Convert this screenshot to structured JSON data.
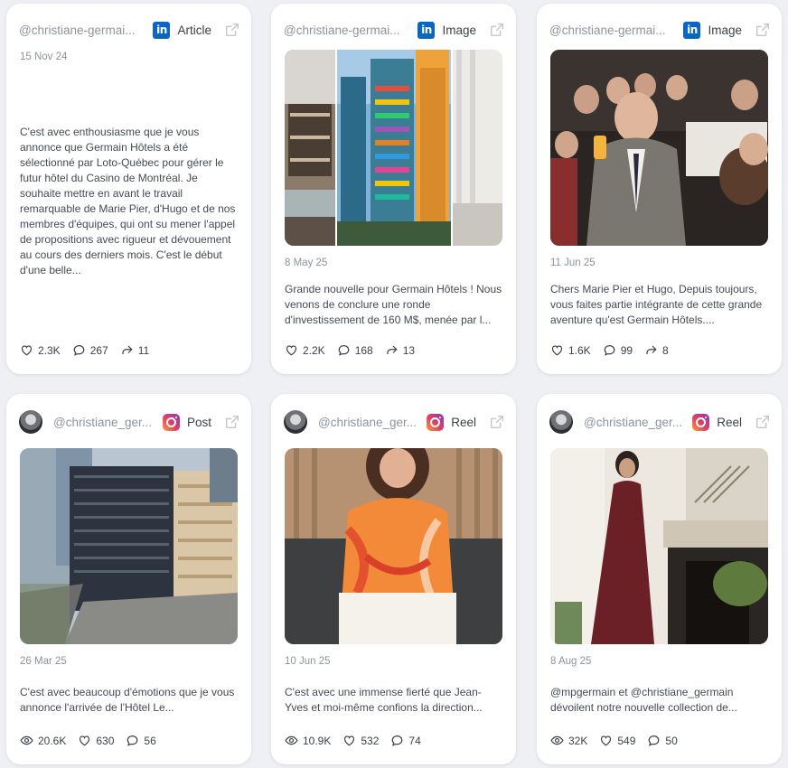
{
  "cards": [
    {
      "handle": "@christiane-germai...",
      "platform": "Article",
      "platform_icon": "linkedin-icon",
      "date": "15 Nov 24",
      "text": "C'est avec enthousiasme que je vous annonce que Germain Hôtels a été sélectionné par Loto-Québec pour gérer le futur hôtel du Casino de Montréal. Je souhaite mettre en avant le travail remarquable de Marie Pier, d'Hugo et de nos membres d'équipes, qui ont su mener l'appel de propositions avec rigueur et dévouement au cours des derniers mois. C'est le début d'une belle...",
      "stats": [
        {
          "icon": "heart-icon",
          "value": "2.3K"
        },
        {
          "icon": "comment-icon",
          "value": "267"
        },
        {
          "icon": "share-icon",
          "value": "11"
        }
      ]
    },
    {
      "handle": "@christiane-germai...",
      "platform": "Image",
      "platform_icon": "linkedin-icon",
      "date": "8 May 25",
      "text": "Grande nouvelle pour Germain Hôtels ! Nous venons de conclure une ronde d'investissement de 160 M$, menée par l...",
      "stats": [
        {
          "icon": "heart-icon",
          "value": "2.2K"
        },
        {
          "icon": "comment-icon",
          "value": "168"
        },
        {
          "icon": "share-icon",
          "value": "13"
        }
      ]
    },
    {
      "handle": "@christiane-germai...",
      "platform": "Image",
      "platform_icon": "linkedin-icon",
      "date": "11 Jun 25",
      "text": "Chers Marie Pier et Hugo, Depuis toujours, vous faites partie intégrante de cette grande aventure qu'est Germain Hôtels....",
      "stats": [
        {
          "icon": "heart-icon",
          "value": "1.6K"
        },
        {
          "icon": "comment-icon",
          "value": "99"
        },
        {
          "icon": "share-icon",
          "value": "8"
        }
      ]
    },
    {
      "handle": "@christiane_ger...",
      "platform": "Post",
      "platform_icon": "instagram-icon",
      "date": "26 Mar 25",
      "text": "C'est avec beaucoup d'émotions que je vous annonce l'arrivée de l'Hôtel Le...",
      "stats": [
        {
          "icon": "eye-icon",
          "value": "20.6K"
        },
        {
          "icon": "heart-icon",
          "value": "630"
        },
        {
          "icon": "comment-icon",
          "value": "56"
        }
      ]
    },
    {
      "handle": "@christiane_ger...",
      "platform": "Reel",
      "platform_icon": "instagram-icon",
      "date": "10 Jun 25",
      "text": "C'est avec une immense fierté que Jean-Yves et moi-même confions la direction...",
      "stats": [
        {
          "icon": "eye-icon",
          "value": "10.9K"
        },
        {
          "icon": "heart-icon",
          "value": "532"
        },
        {
          "icon": "comment-icon",
          "value": "74"
        }
      ]
    },
    {
      "handle": "@christiane_ger...",
      "platform": "Reel",
      "platform_icon": "instagram-icon",
      "date": "8 Aug 25",
      "text": "@mpgermain et @christiane_germain dévoilent notre nouvelle collection de...",
      "stats": [
        {
          "icon": "eye-icon",
          "value": "32K"
        },
        {
          "icon": "heart-icon",
          "value": "549"
        },
        {
          "icon": "comment-icon",
          "value": "50"
        }
      ]
    }
  ],
  "colors": {
    "linkedin": "#0a66c2",
    "background": "#eef0f4",
    "muted_text": "#8d93a0"
  }
}
